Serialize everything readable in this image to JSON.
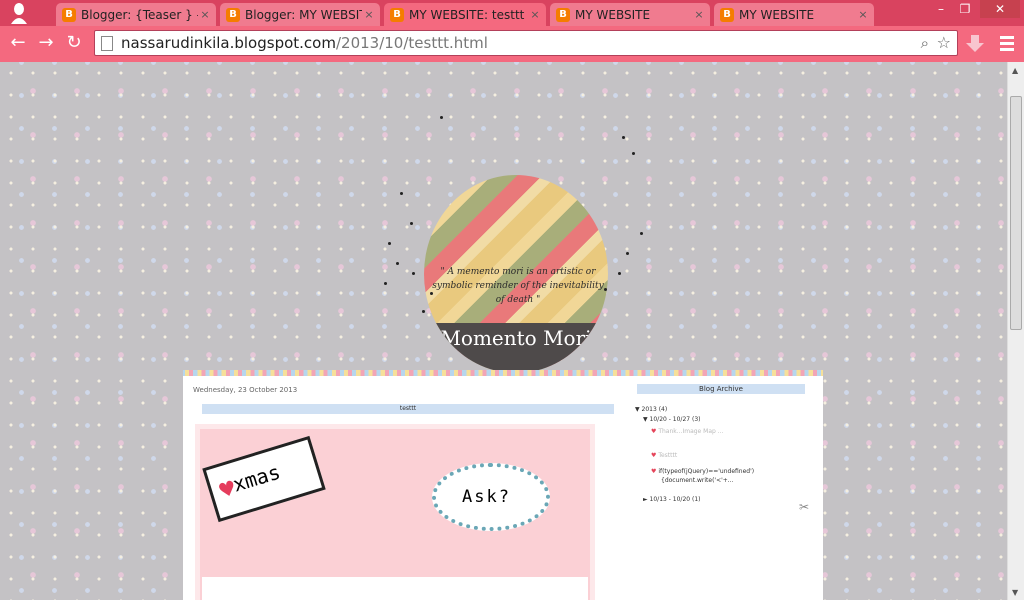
{
  "browser": {
    "tabs": [
      {
        "title": "Blogger: {Teaser } - C",
        "favicon": "B"
      },
      {
        "title": "Blogger: MY WEBSITE",
        "favicon": "B"
      },
      {
        "title": "MY WEBSITE: testtt",
        "favicon": "B"
      },
      {
        "title": "MY WEBSITE",
        "favicon": "B"
      },
      {
        "title": "MY WEBSITE",
        "favicon": "B"
      }
    ],
    "tab_close": "×",
    "window": {
      "minimize": "–",
      "restore": "❐",
      "close": "✕"
    },
    "url_host": "nassarudinkila.blogspot.com",
    "url_path": "/2013/10/testtt.html",
    "nav": {
      "back": "←",
      "forward": "→",
      "reload": "↻"
    },
    "accent_color": "#f4697f"
  },
  "header": {
    "quote": "\" A memento mori is an artistic or symbolic reminder of the inevitability of death \"",
    "blog_name": "Momento Mori"
  },
  "post": {
    "date": "Wednesday, 23 October 2013",
    "title": "testtt",
    "xmas_label": "xmas",
    "ask_label": "Ask?"
  },
  "sidebar": {
    "archive_title": "Blog Archive",
    "year": "2013 (4)",
    "week1": "10/20 - 10/27 (3)",
    "item1": "Thank...Image Map ...",
    "item2": "Testttt",
    "item3": "if(typeof(jQuery)=='undefined')",
    "item3b": "{document.write('<'+...",
    "week2": "10/13 - 10/20 (1)"
  }
}
